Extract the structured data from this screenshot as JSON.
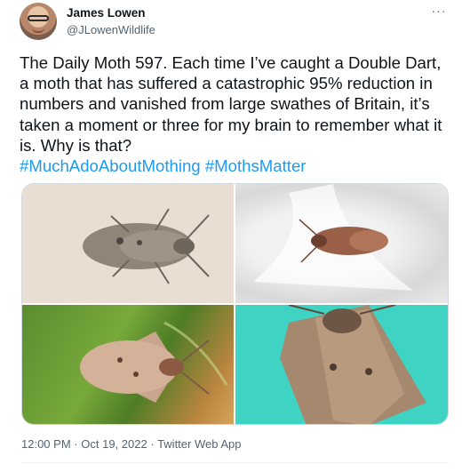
{
  "author": {
    "name": "James Lowen",
    "handle": "@JLowenWildlife"
  },
  "menu": {
    "more_icon": "more-horizontal-icon",
    "more_label": "···"
  },
  "tweet": {
    "text": "The Daily Moth 597. Each time I’ve caught a Double Dart, a moth that has suffered a catastrophic 95% reduction in numbers and vanished from large swathes of Britain, it’s taken a moment or three for my brain to remember what it is. Why is that?",
    "hashtags": [
      "#MuchAdoAboutMothing",
      "#MothsMatter"
    ]
  },
  "meta": {
    "time": "12:00 PM",
    "separator": "·",
    "date": "Oct 19, 2022",
    "source": "Twitter Web App"
  },
  "colors": {
    "link": "#1d9bf0",
    "secondary_text": "#536471"
  }
}
